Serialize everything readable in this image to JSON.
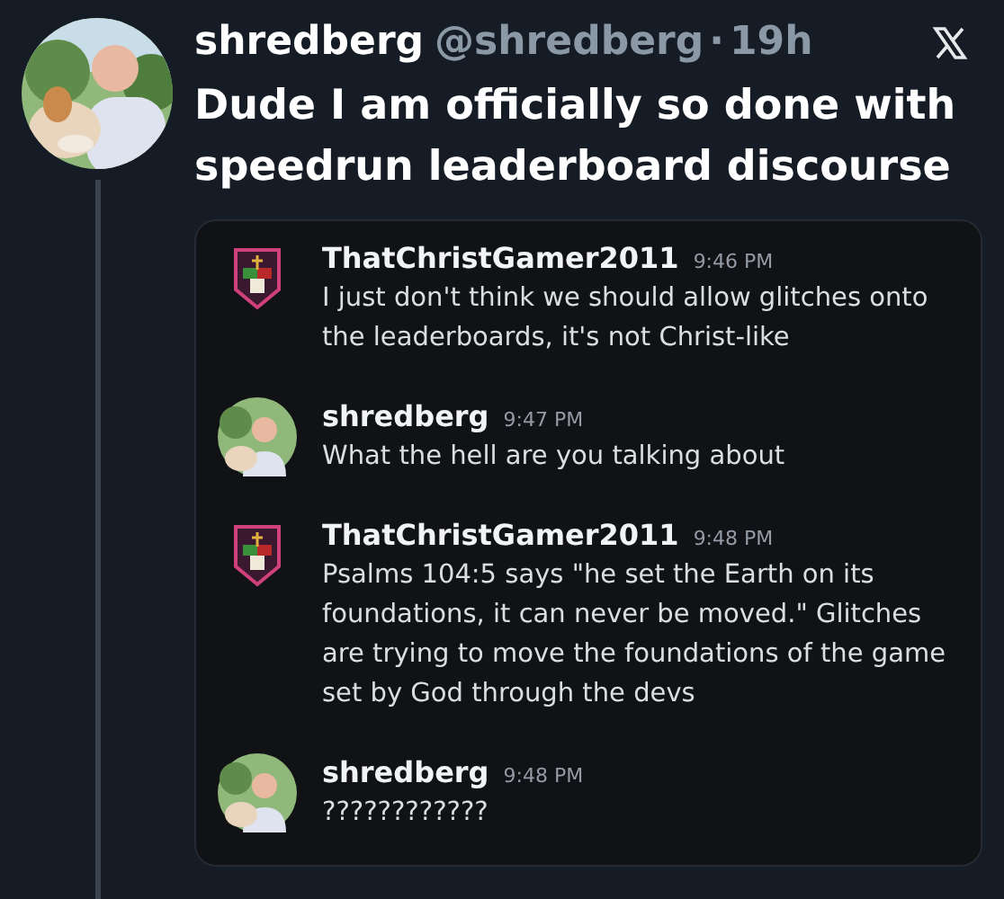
{
  "tweet": {
    "display_name": "shredberg",
    "handle": "@shredberg",
    "separator": "·",
    "time": "19h",
    "text": "Dude I am officially so done with speedrun leaderboard discourse"
  },
  "chat": {
    "messages": [
      {
        "kind": "emblem",
        "author": "ThatChristGamer2011",
        "time": "9:46 PM",
        "text": "I just don't think we should allow glitches onto the leaderboards, it's not Christ-like"
      },
      {
        "author": "shredberg",
        "time": "9:47 PM",
        "text": "What the hell are you talking about"
      },
      {
        "kind": "emblem",
        "author": "ThatChristGamer2011",
        "time": "9:48 PM",
        "text": "Psalms 104:5 says \"he set the Earth on its foundations, it can never be moved.\" Glitches are trying to move the foundations of the game set by God through the devs"
      },
      {
        "author": "shredberg",
        "time": "9:48 PM",
        "text": "????????????"
      }
    ]
  }
}
